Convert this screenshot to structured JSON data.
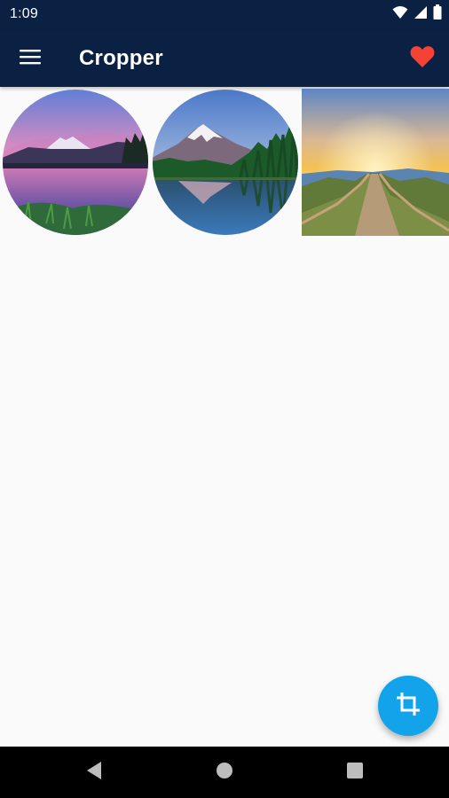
{
  "status_bar": {
    "time": "1:09",
    "icons": [
      "wifi-icon",
      "signal-icon",
      "battery-icon"
    ]
  },
  "app_bar": {
    "title": "Cropper",
    "menu_icon": "menu-icon",
    "action_icon": "heart-icon"
  },
  "gallery": {
    "items": [
      {
        "name": "sunset-lake-mountain",
        "shape": "circle"
      },
      {
        "name": "snowy-mountain-lake",
        "shape": "circle"
      },
      {
        "name": "sunrise-trail",
        "shape": "square"
      }
    ]
  },
  "fab": {
    "icon": "crop-icon"
  },
  "navigation": {
    "icons": [
      "back-icon",
      "home-icon",
      "recents-icon"
    ]
  },
  "colors": {
    "app_bar": "#0b2143",
    "accent_heart": "#f44336",
    "fab": "#13a3ea",
    "background": "#fafafa"
  }
}
